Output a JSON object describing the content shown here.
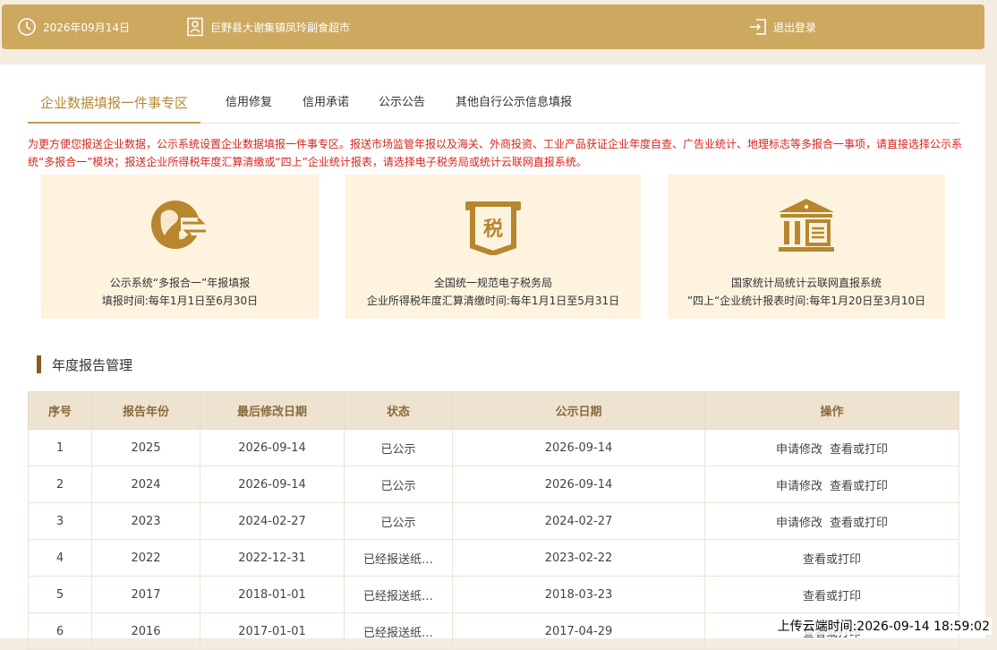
{
  "header": {
    "date": "2026年09月14日",
    "shop_name": "巨野县大谢集镇凤玲副食超市",
    "logout_label": "退出登录"
  },
  "tabs": [
    {
      "label": "企业数据填报一件事专区",
      "active": true
    },
    {
      "label": "信用修复"
    },
    {
      "label": "信用承诺"
    },
    {
      "label": "公示公告"
    },
    {
      "label": "其他自行公示信息填报"
    }
  ],
  "notice": "为更方便您报送企业数据，公示系统设置企业数据填报一件事专区。报送市场监管年报以及海关、外商投资、工业产品获证企业年度自查、广告业统计、地理标志等多报合一事项，请直接选择公示系统“多报合一”模块；报送企业所得税年度汇算清缴或“四上”企业统计报表，请选择电子税务局或统计云联网直报系统。",
  "cards": [
    {
      "icon": "globe-exchange-icon",
      "line1": "公示系统“多报合一”年报填报",
      "line2": "填报时间:每年1月1日至6月30日"
    },
    {
      "icon": "tax-receipt-icon",
      "icon_text": "税",
      "line1": "全国统一规范电子税务局",
      "line2": "企业所得税年度汇算清缴时间:每年1月1日至5月31日"
    },
    {
      "icon": "government-building-icon",
      "line1": "国家统计局统计云联网直报系统",
      "line2": "”四上“企业统计报表时间:每年1月20日至3月10日"
    }
  ],
  "section_title": "年度报告管理",
  "table": {
    "headers": [
      "序号",
      "报告年份",
      "最后修改日期",
      "状态",
      "公示日期",
      "操作"
    ],
    "rows": [
      {
        "no": "1",
        "year": "2025",
        "modified": "2026-09-14",
        "status": "已公示",
        "publish": "2026-09-14",
        "actions": [
          "申请修改",
          "查看或打印"
        ]
      },
      {
        "no": "2",
        "year": "2024",
        "modified": "2026-09-14",
        "status": "已公示",
        "publish": "2026-09-14",
        "actions": [
          "申请修改",
          "查看或打印"
        ]
      },
      {
        "no": "3",
        "year": "2023",
        "modified": "2024-02-27",
        "status": "已公示",
        "publish": "2024-02-27",
        "actions": [
          "申请修改",
          "查看或打印"
        ]
      },
      {
        "no": "4",
        "year": "2022",
        "modified": "2022-12-31",
        "status": "已经报送纸…",
        "publish": "2023-02-22",
        "actions": [
          "查看或打印"
        ]
      },
      {
        "no": "5",
        "year": "2017",
        "modified": "2018-01-01",
        "status": "已经报送纸…",
        "publish": "2018-03-23",
        "actions": [
          "查看或打印"
        ]
      },
      {
        "no": "6",
        "year": "2016",
        "modified": "2017-01-01",
        "status": "已经报送纸…",
        "publish": "2017-04-29",
        "actions": [
          "查看或打印"
        ]
      }
    ]
  },
  "upload_time": "上传云端时间:2026-09-14 18:59:02",
  "colors": {
    "brand": "#cda85f",
    "icon": "#b8862e",
    "notice": "#d8241c"
  }
}
